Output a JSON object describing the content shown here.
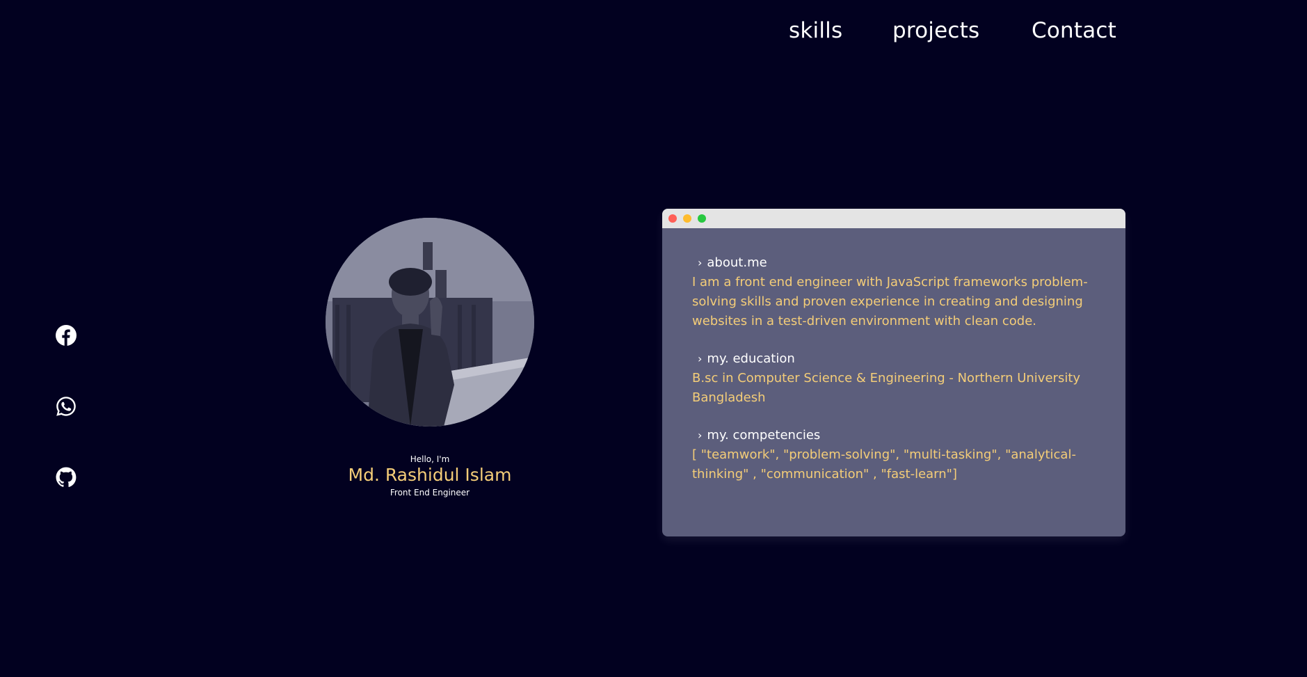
{
  "nav": {
    "items": [
      "skills",
      "projects",
      "Contact"
    ]
  },
  "social": {
    "icons": [
      "facebook-icon",
      "whatsapp-icon",
      "github-icon"
    ]
  },
  "profile": {
    "greeting": "Hello, I'm",
    "name": "Md. Rashidul Islam",
    "title": "Front End Engineer"
  },
  "terminal": {
    "sections": [
      {
        "heading": "about.me",
        "text": "I am a front end engineer with JavaScript frameworks problem-solving skills and proven experience in creating and designing websites in a test-driven environment with clean code."
      },
      {
        "heading": "my. education",
        "text": "B.sc in Computer Science & Engineering - Northern University Bangladesh"
      },
      {
        "heading": "my. competencies",
        "text": "[ \"teamwork\", \"problem-solving\", \"multi-tasking\", \"analytical-thinking\" , \"communication\" , \"fast-learn\"]"
      }
    ]
  },
  "colors": {
    "background": "#020120",
    "accent": "#f4cd78",
    "window_body": "#5c5e7c",
    "titlebar": "#e4e4e4"
  }
}
